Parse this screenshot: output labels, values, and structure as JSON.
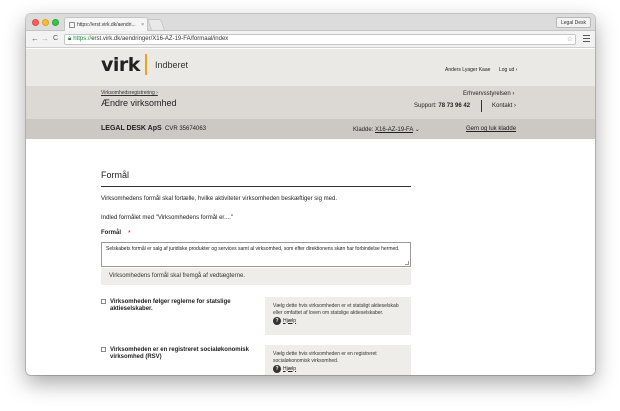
{
  "browser": {
    "tab_title": "https://erst.virk.dk/aendri...",
    "tab_close": "×",
    "profile": "Legal Desk",
    "url_scheme": "https://",
    "url_rest": "erst.virk.dk/aendringer/X16-AZ-19-FA/formaal/index",
    "nav_back": "←",
    "nav_forward": "→",
    "nav_reload": "C"
  },
  "header": {
    "logo": "virk",
    "logo_sub": "Indberet",
    "user": "Anders Lyager Kaae",
    "logout": "Log ud ›",
    "accent_color": "#f0a21d"
  },
  "subheader": {
    "breadcrumb": "Virksomhedsregistrering ›",
    "title": "Ændre virksomhed",
    "erhverv": "Erhvervsstyrelsen ›",
    "support_label": "Support:",
    "support_phone": "78 73 96 42",
    "kontakt": "Kontakt ›"
  },
  "company": {
    "name": "LEGAL DESK ApS",
    "cvr": "CVR 35674063",
    "kladde_label": "Kladde:",
    "kladde_id": "X16-AZ-19-FA",
    "save_close": "Gem og luk kladde"
  },
  "form": {
    "heading": "Formål",
    "intro": "Virksomhedens formål skal fortælle, hvilke aktiviteter virksomheden beskæftiger sig med.",
    "instruction": "Indled formålet med \"Virksomhedens formål er....\"",
    "field_label": "Formål",
    "required_mark": "*",
    "field_value": "Selskabets formål er salg af juridiske produkter og services samt al virksomhed, som efter direktionens skøn har forbindelse hermed.",
    "field_hint": "Virksomhedens formål skal fremgå af vedtægterne.",
    "checkboxes": [
      {
        "label": "Virksomheden følger reglerne for statslige aktieselskaber.",
        "info": "Vælg dette hvis virksomheden er et statsligt aktieselskab eller omfattet af loven om statslige aktieselskaber.",
        "help": "Hjælp"
      },
      {
        "label": "Virksomheden er en registreret socialøkonomisk virksomhed (RSV)",
        "info": "Vælg dette hvis virksomheden er en registreret socialøkonomisk virksomhed.",
        "help": "Hjælp"
      }
    ]
  }
}
